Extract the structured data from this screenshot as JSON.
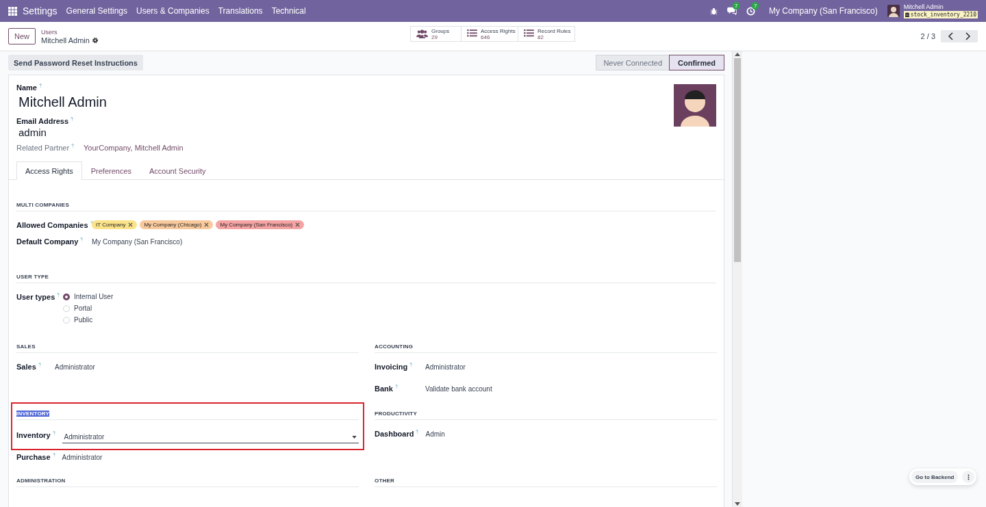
{
  "navbar": {
    "app_name": "Settings",
    "menu": [
      "General Settings",
      "Users & Companies",
      "Translations",
      "Technical"
    ],
    "messages_count": "7",
    "activities_count": "7",
    "company": "My Company (San Francisco)",
    "user_name": "Mitchell Admin",
    "database": "stock_inventory_2210"
  },
  "control_panel": {
    "new_button": "New",
    "breadcrumb_parent": "Users",
    "breadcrumb_current": "Mitchell Admin",
    "smart_buttons": [
      {
        "kind": "groups",
        "label": "Groups",
        "count": "29"
      },
      {
        "kind": "list",
        "label": "Access Rights",
        "count": "646"
      },
      {
        "kind": "list",
        "label": "Record Rules",
        "count": "82"
      }
    ],
    "pager": "2 / 3"
  },
  "status_bar": {
    "action_button": "Send Password Reset Instructions",
    "stages": [
      {
        "label": "Never Connected",
        "selected": false
      },
      {
        "label": "Confirmed",
        "selected": true
      }
    ]
  },
  "form": {
    "name_label": "Name",
    "name": "Mitchell Admin",
    "email_label": "Email Address",
    "email": "admin",
    "partner_label": "Related Partner",
    "partner": "YourCompany, Mitchell Admin",
    "tabs": [
      {
        "label": "Access Rights",
        "selected": true
      },
      {
        "label": "Preferences",
        "selected": false
      },
      {
        "label": "Account Security",
        "selected": false
      }
    ],
    "wide_sections": [
      {
        "title": "MULTI COMPANIES",
        "rows": [
          {
            "kind": "tags",
            "label": "Allowed Companies",
            "tags": [
              {
                "text": "IT Company",
                "color": "#fbe38a"
              },
              {
                "text": "My Company (Chicago)",
                "color": "#f8c99c"
              },
              {
                "text": "My Company (San Francisco)",
                "color": "#f5a3a3"
              }
            ]
          },
          {
            "kind": "text",
            "label": "Default Company",
            "value": "My Company (San Francisco)"
          }
        ]
      },
      {
        "title": "USER TYPE",
        "rows": [
          {
            "kind": "radio",
            "label": "User types",
            "options": [
              {
                "text": "Internal User",
                "selected": true
              },
              {
                "text": "Portal",
                "selected": false
              },
              {
                "text": "Public",
                "selected": false
              }
            ]
          }
        ]
      }
    ],
    "column_sections": [
      {
        "title": "SALES",
        "highlighted": false,
        "title_selected": false,
        "rows": [
          {
            "kind": "text",
            "label": "Sales",
            "value": "Administrator"
          }
        ]
      },
      {
        "title": "ACCOUNTING",
        "highlighted": false,
        "title_selected": false,
        "rows": [
          {
            "kind": "text",
            "label": "Invoicing",
            "value": "Administrator"
          },
          {
            "kind": "text",
            "label": "Bank",
            "value": "Validate bank account"
          }
        ]
      },
      {
        "title": "INVENTORY",
        "highlighted": true,
        "title_selected": true,
        "rows": [
          {
            "kind": "select",
            "label": "Inventory",
            "value": "Administrator"
          },
          {
            "kind": "text",
            "label": "Purchase",
            "value": "Administrator"
          }
        ]
      },
      {
        "title": "PRODUCTIVITY",
        "highlighted": false,
        "title_selected": false,
        "rows": [
          {
            "kind": "text",
            "label": "Dashboard",
            "value": "Admin"
          }
        ]
      },
      {
        "title": "ADMINISTRATION",
        "highlighted": false,
        "title_selected": false
      },
      {
        "title": "OTHER",
        "highlighted": false,
        "title_selected": false
      }
    ]
  },
  "floating": {
    "button": "Go to Backend"
  }
}
